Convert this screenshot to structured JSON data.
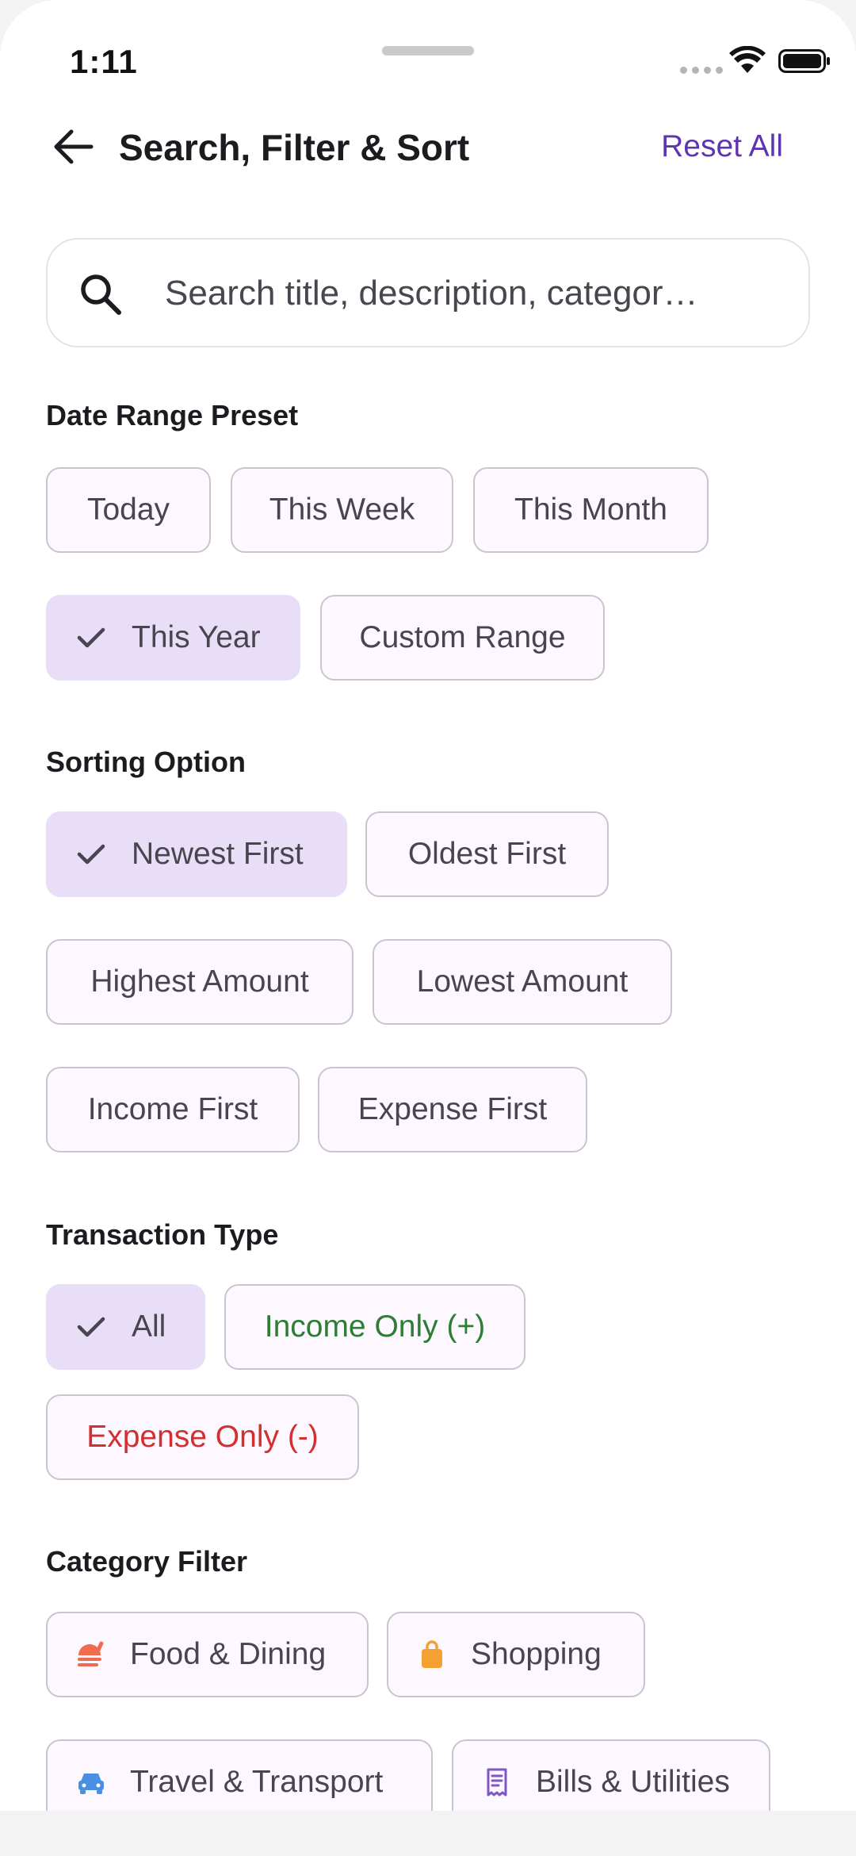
{
  "status_bar": {
    "time": "1:11"
  },
  "header": {
    "title": "Search, Filter & Sort",
    "reset_label": "Reset All"
  },
  "search": {
    "placeholder": "Search title, description, categor…"
  },
  "date_range": {
    "title": "Date Range Preset",
    "chips": [
      {
        "label": "Today",
        "selected": false
      },
      {
        "label": "This Week",
        "selected": false
      },
      {
        "label": "This Month",
        "selected": false
      },
      {
        "label": "This Year",
        "selected": true
      },
      {
        "label": "Custom Range",
        "selected": false
      }
    ]
  },
  "sorting": {
    "title": "Sorting Option",
    "chips": [
      {
        "label": "Newest First",
        "selected": true
      },
      {
        "label": "Oldest First",
        "selected": false
      },
      {
        "label": "Highest Amount",
        "selected": false
      },
      {
        "label": "Lowest Amount",
        "selected": false
      },
      {
        "label": "Income First",
        "selected": false
      },
      {
        "label": "Expense First",
        "selected": false
      }
    ]
  },
  "transaction_type": {
    "title": "Transaction Type",
    "chips": [
      {
        "label": "All",
        "selected": true
      },
      {
        "label": "Income Only (+)",
        "selected": false,
        "color": "#2e7d32"
      },
      {
        "label": "Expense Only (-)",
        "selected": false,
        "color": "#d32f2f"
      }
    ]
  },
  "category": {
    "title": "Category Filter",
    "chips": [
      {
        "label": "Food & Dining",
        "icon": "food-icon",
        "icon_color": "#f26b4f"
      },
      {
        "label": "Shopping",
        "icon": "shopping-bag-icon",
        "icon_color": "#f5a033"
      },
      {
        "label": "Travel & Transport",
        "icon": "car-icon",
        "icon_color": "#4a90e2"
      },
      {
        "label": "Bills & Utilities",
        "icon": "receipt-icon",
        "icon_color": "#7e57c2"
      }
    ]
  },
  "colors": {
    "accent": "#5e35b1",
    "chip_selected_bg": "#e8def8",
    "chip_bg": "#fdf7ff",
    "chip_border": "#cac4d0"
  }
}
